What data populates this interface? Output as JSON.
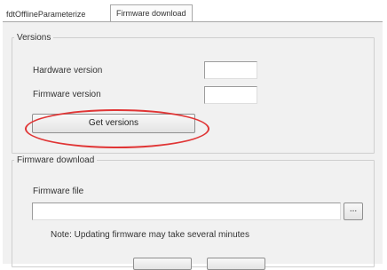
{
  "tabs": [
    "fdtOfflineParameterize",
    "Firmware download"
  ],
  "versions_group": {
    "legend": "Versions",
    "hardware_label": "Hardware version",
    "hardware_value": "",
    "firmware_label": "Firmware version",
    "firmware_value": "",
    "get_button": "Get versions"
  },
  "download_group": {
    "legend": "Firmware download",
    "file_label": "Firmware file",
    "file_value": "",
    "browse_button": "...",
    "note": "Note: Updating firmware may take several minutes"
  },
  "annotation": {
    "highlight_color": "#e03535"
  }
}
